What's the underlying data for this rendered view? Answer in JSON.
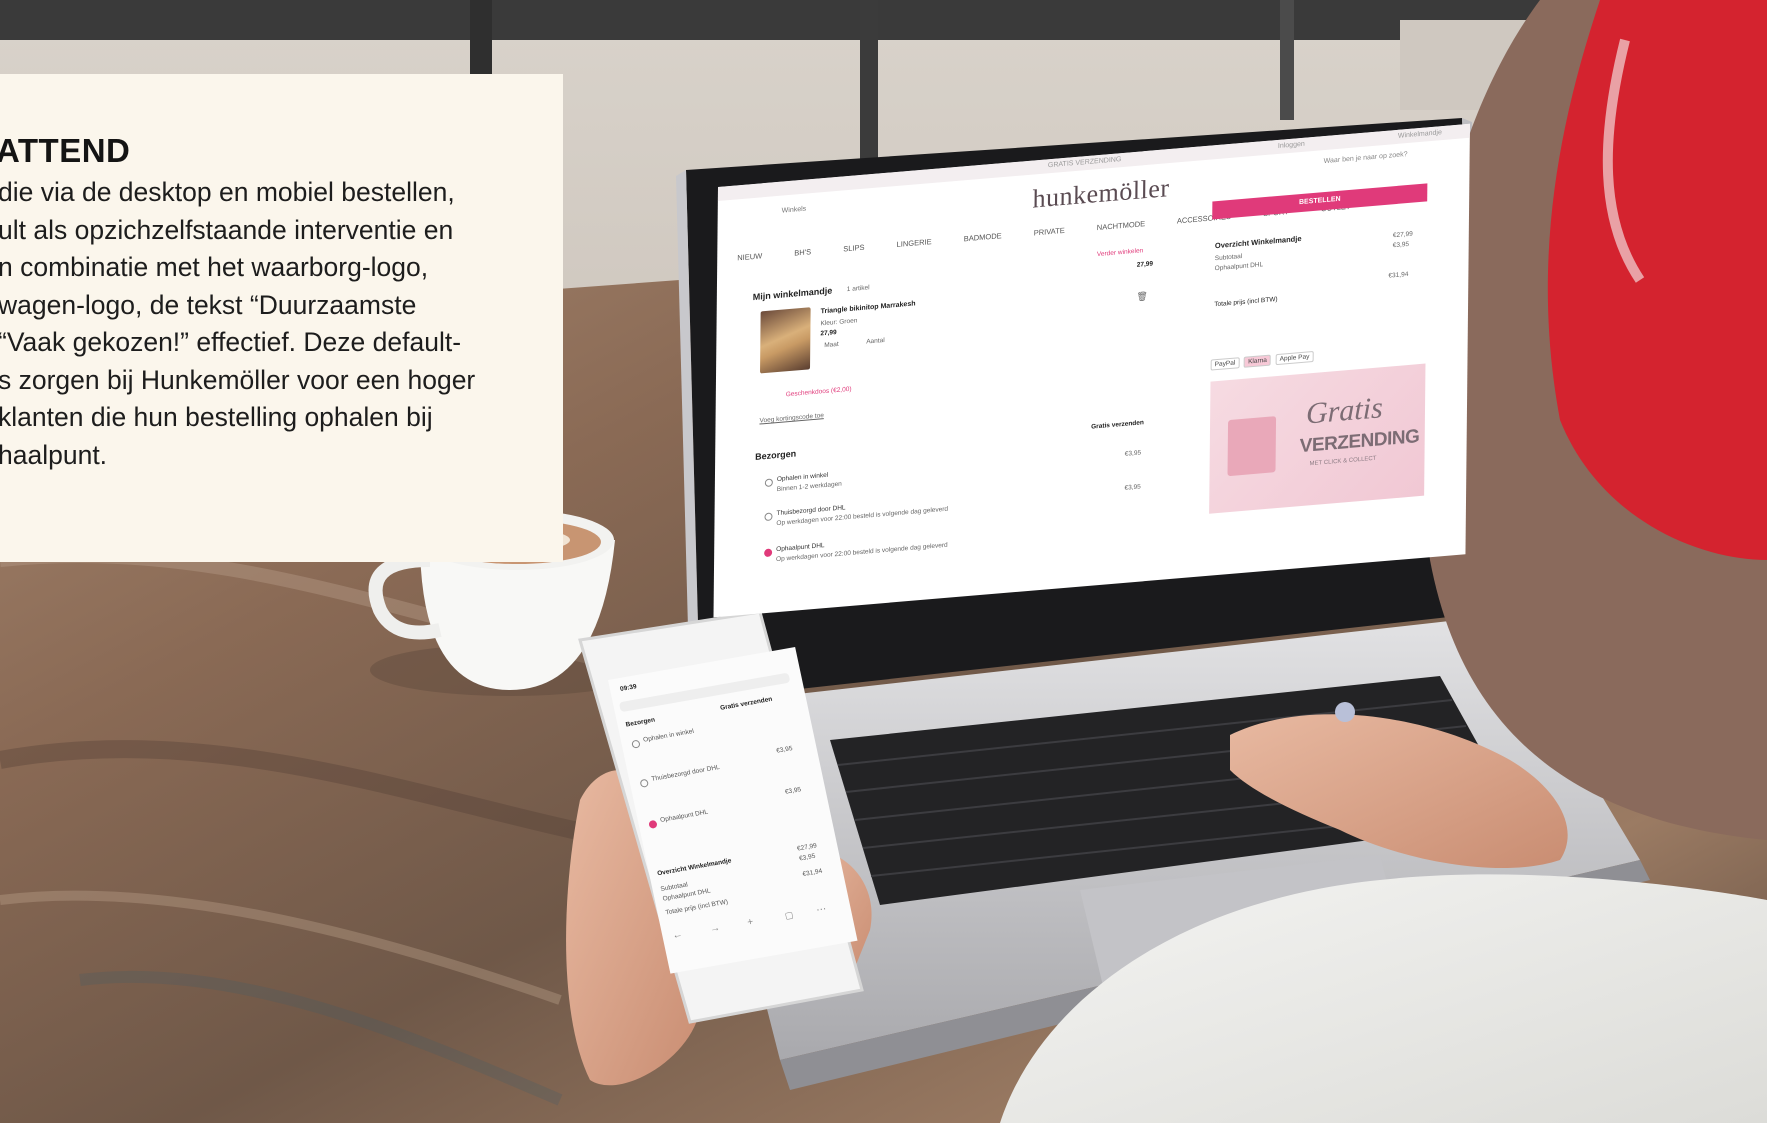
{
  "card": {
    "heading": "ATTEND",
    "lines": [
      "die via de desktop en mobiel bestellen,",
      "ult als opzichzelfstaande interventie en",
      "n combinatie met het waarborg-logo,",
      "wagen-logo, de tekst “Duurzaamste",
      "“Vaak gekozen!” effectief. Deze default-",
      "s zorgen bij Hunkemöller voor een hoger",
      "klanten die hun bestelling ophalen bij",
      "haalpunt."
    ]
  },
  "laptop": {
    "top_banner": "GRATIS VERZENDING",
    "top_right_links": [
      "Inloggen",
      "Winkelmandje"
    ],
    "search_label": "Winkels",
    "search_placeholder": "Waar ben je naar op zoek?",
    "brand": "hunkemöller",
    "nav": [
      "NIEUW",
      "BH'S",
      "SLIPS",
      "LINGERIE",
      "BADMODE",
      "PRIVATE",
      "NACHTMODE",
      "ACCESSOIRES",
      "SPORT",
      "OUTLET"
    ],
    "cta_label": "BESTELLEN",
    "continue_link": "Verder winkelen",
    "cart_title": "Mijn winkelmandje",
    "cart_count": "1 artikel",
    "cart_total_top": "27,99",
    "product": {
      "name": "Triangle bikinitop Marrakesh",
      "variant": "Kleur: Groen",
      "price": "27,99",
      "size_label": "Maat",
      "qty_label": "Aantal"
    },
    "gift_box": "Geschenkdoos (€2,00)",
    "discount_link": "Voeg kortingscode toe",
    "delivery_title": "Bezorgen",
    "delivery_free": "Gratis verzenden",
    "delivery_options": [
      {
        "label": "Ophalen in winkel",
        "detail": "Binnen 1-2 werkdagen",
        "price": "€3,95"
      },
      {
        "label": "Thuisbezorgd door DHL",
        "detail": "Op werkdagen voor 22:00 besteld is volgende dag geleverd",
        "price": "€3,95"
      },
      {
        "label": "Ophaalpunt DHL",
        "detail": "Op werkdagen voor 22:00 besteld is volgende dag geleverd",
        "price": ""
      }
    ],
    "summary": {
      "title": "Overzicht Winkelmandje",
      "subtotal_label": "Subtotaal",
      "subtotal": "€27,99",
      "shipping_label": "Ophaalpunt DHL",
      "shipping": "€3,95",
      "total_label": "Totale prijs (incl BTW)",
      "total": "€31,94"
    },
    "payment_methods": [
      "PayPal",
      "Klarna",
      "Apple Pay"
    ],
    "promo": {
      "line1": "Gratis",
      "line2": "VERZENDING",
      "line3": "MET CLICK & COLLECT"
    }
  },
  "phone": {
    "time": "09:39",
    "delivery_title": "Bezorgen",
    "delivery_free": "Gratis verzenden",
    "options": [
      {
        "label": "Ophalen in winkel",
        "price": ""
      },
      {
        "label": "Thuisbezorgd door DHL",
        "price": "€3,95"
      },
      {
        "label": "Ophaalpunt DHL",
        "price": "€3,95"
      }
    ],
    "summary_title": "Overzicht Winkelmandje",
    "subtotal_label": "Subtotaal",
    "subtotal": "€27,99",
    "shipping_label": "Ophaalpunt DHL",
    "shipping": "€3,95",
    "total_label": "Totale prijs (incl BTW)",
    "total": "€31,94"
  },
  "colors": {
    "card_background": "#fbf6ec",
    "accent_pink": "#e03a7a",
    "laptop_body": "#c9c9cc",
    "table_wood": "#8a6a55",
    "headband_red": "#d4232f"
  }
}
